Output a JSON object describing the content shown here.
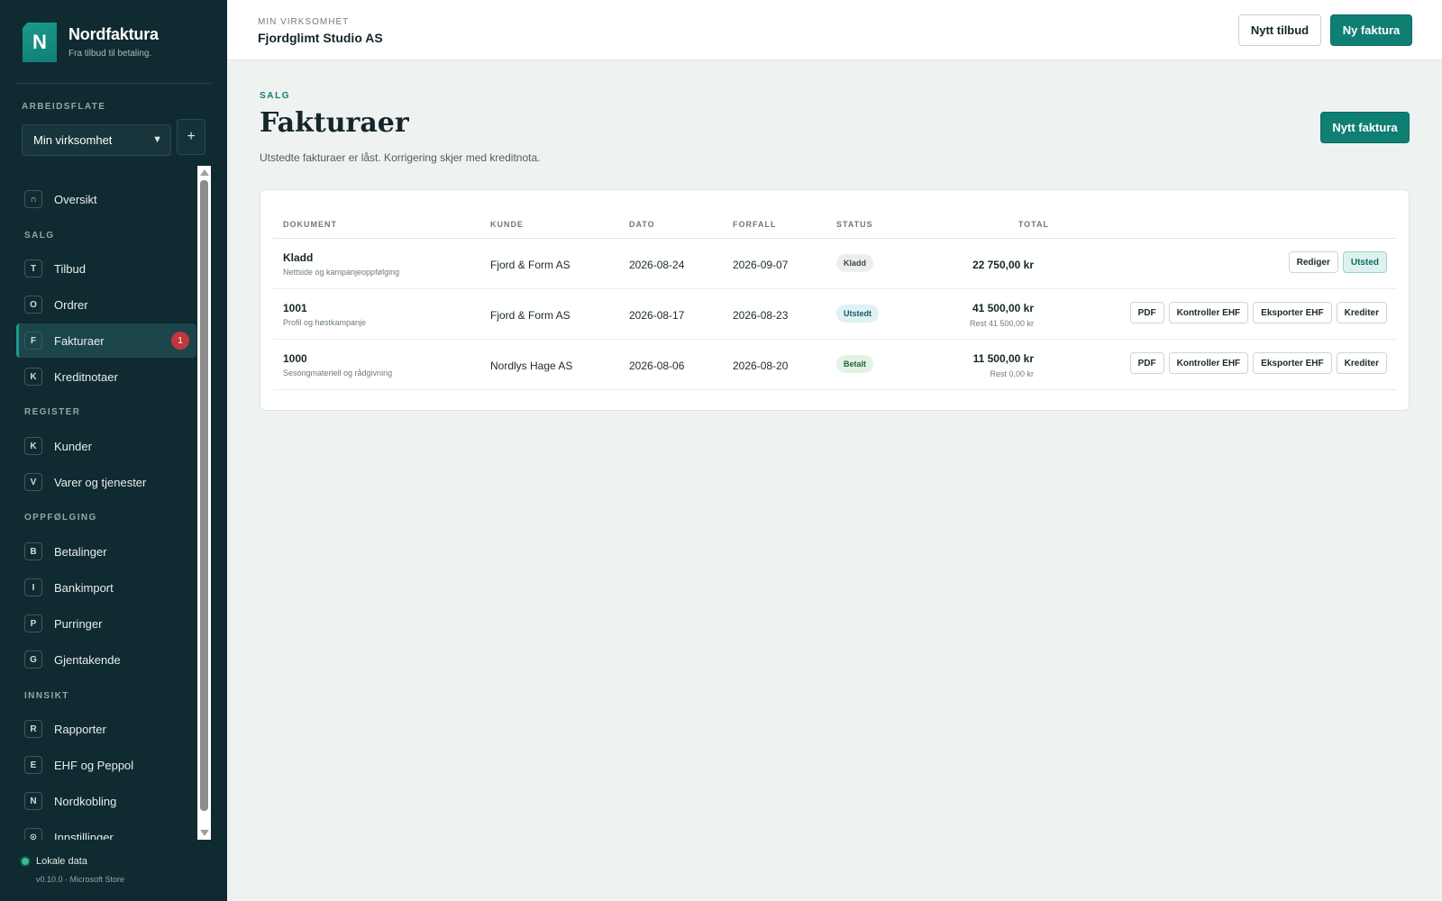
{
  "brand": {
    "logo_letter": "N",
    "name": "Nordfaktura",
    "tagline": "Fra tilbud til betaling."
  },
  "workspace": {
    "label": "ARBEIDSFLATE",
    "selected": "Min virksomhet",
    "add_label": "+"
  },
  "nav": {
    "overview": {
      "key": "∩",
      "label": "Oversikt"
    },
    "sections": {
      "salg": "SALG",
      "register": "REGISTER",
      "oppfolging": "OPPFØLGING",
      "innsikt": "INNSIKT"
    },
    "tilbud": {
      "key": "T",
      "label": "Tilbud"
    },
    "ordrer": {
      "key": "O",
      "label": "Ordrer"
    },
    "fakturaer": {
      "key": "F",
      "label": "Fakturaer",
      "badge": "1"
    },
    "kreditnotaer": {
      "key": "K",
      "label": "Kreditnotaer"
    },
    "kunder": {
      "key": "K",
      "label": "Kunder"
    },
    "varer": {
      "key": "V",
      "label": "Varer og tjenester"
    },
    "betalinger": {
      "key": "B",
      "label": "Betalinger"
    },
    "bankimport": {
      "key": "I",
      "label": "Bankimport"
    },
    "purringer": {
      "key": "P",
      "label": "Purringer"
    },
    "gjentakende": {
      "key": "G",
      "label": "Gjentakende"
    },
    "rapporter": {
      "key": "R",
      "label": "Rapporter"
    },
    "ehf": {
      "key": "E",
      "label": "EHF og Peppol"
    },
    "nordkobling": {
      "key": "N",
      "label": "Nordkobling"
    },
    "innstillinger": {
      "key": "⊙",
      "label": "Innstillinger"
    }
  },
  "footer": {
    "local_label": "Lokale data",
    "version": "v0.10.0 · Microsoft Store"
  },
  "topbar": {
    "subtitle": "MIN VIRKSOMHET",
    "company": "Fjordglimt Studio AS",
    "new_quote": "Nytt tilbud",
    "new_invoice": "Ny faktura"
  },
  "page": {
    "eyebrow": "SALG",
    "title": "Fakturaer",
    "description": "Utstedte fakturaer er låst. Korrigering skjer med kreditnota.",
    "new_button": "Nytt faktura"
  },
  "table": {
    "headers": {
      "dokument": "DOKUMENT",
      "kunde": "KUNDE",
      "dato": "DATO",
      "forfall": "FORFALL",
      "status": "STATUS",
      "total": "TOTAL"
    },
    "rows": [
      {
        "doc": "Kladd",
        "desc": "Nettside og kampanjeoppfølging",
        "customer": "Fjord & Form AS",
        "date": "2026-08-24",
        "due": "2026-09-07",
        "status": "Kladd",
        "total": "22 750,00 kr",
        "rest": "",
        "actions": [
          "Rediger",
          "Utsted"
        ]
      },
      {
        "doc": "1001",
        "desc": "Profil og høstkampanje",
        "customer": "Fjord & Form AS",
        "date": "2026-08-17",
        "due": "2026-08-23",
        "status": "Utstedt",
        "total": "41 500,00 kr",
        "rest": "Rest 41 500,00 kr",
        "actions": [
          "PDF",
          "Kontroller EHF",
          "Eksporter EHF",
          "Krediter"
        ]
      },
      {
        "doc": "1000",
        "desc": "Sesongmateriell og rådgivning",
        "customer": "Nordlys Hage AS",
        "date": "2026-08-06",
        "due": "2026-08-20",
        "status": "Betalt",
        "total": "11 500,00 kr",
        "rest": "Rest 0,00 kr",
        "actions": [
          "PDF",
          "Kontroller EHF",
          "Eksporter EHF",
          "Krediter"
        ]
      }
    ]
  },
  "colors": {
    "sidebar": "#0f2a30",
    "accent": "#0f7f74",
    "badge": "#c0363d",
    "status_draft": "#eceeee",
    "status_issued": "#dff1f4",
    "status_paid": "#e2f3e6"
  }
}
